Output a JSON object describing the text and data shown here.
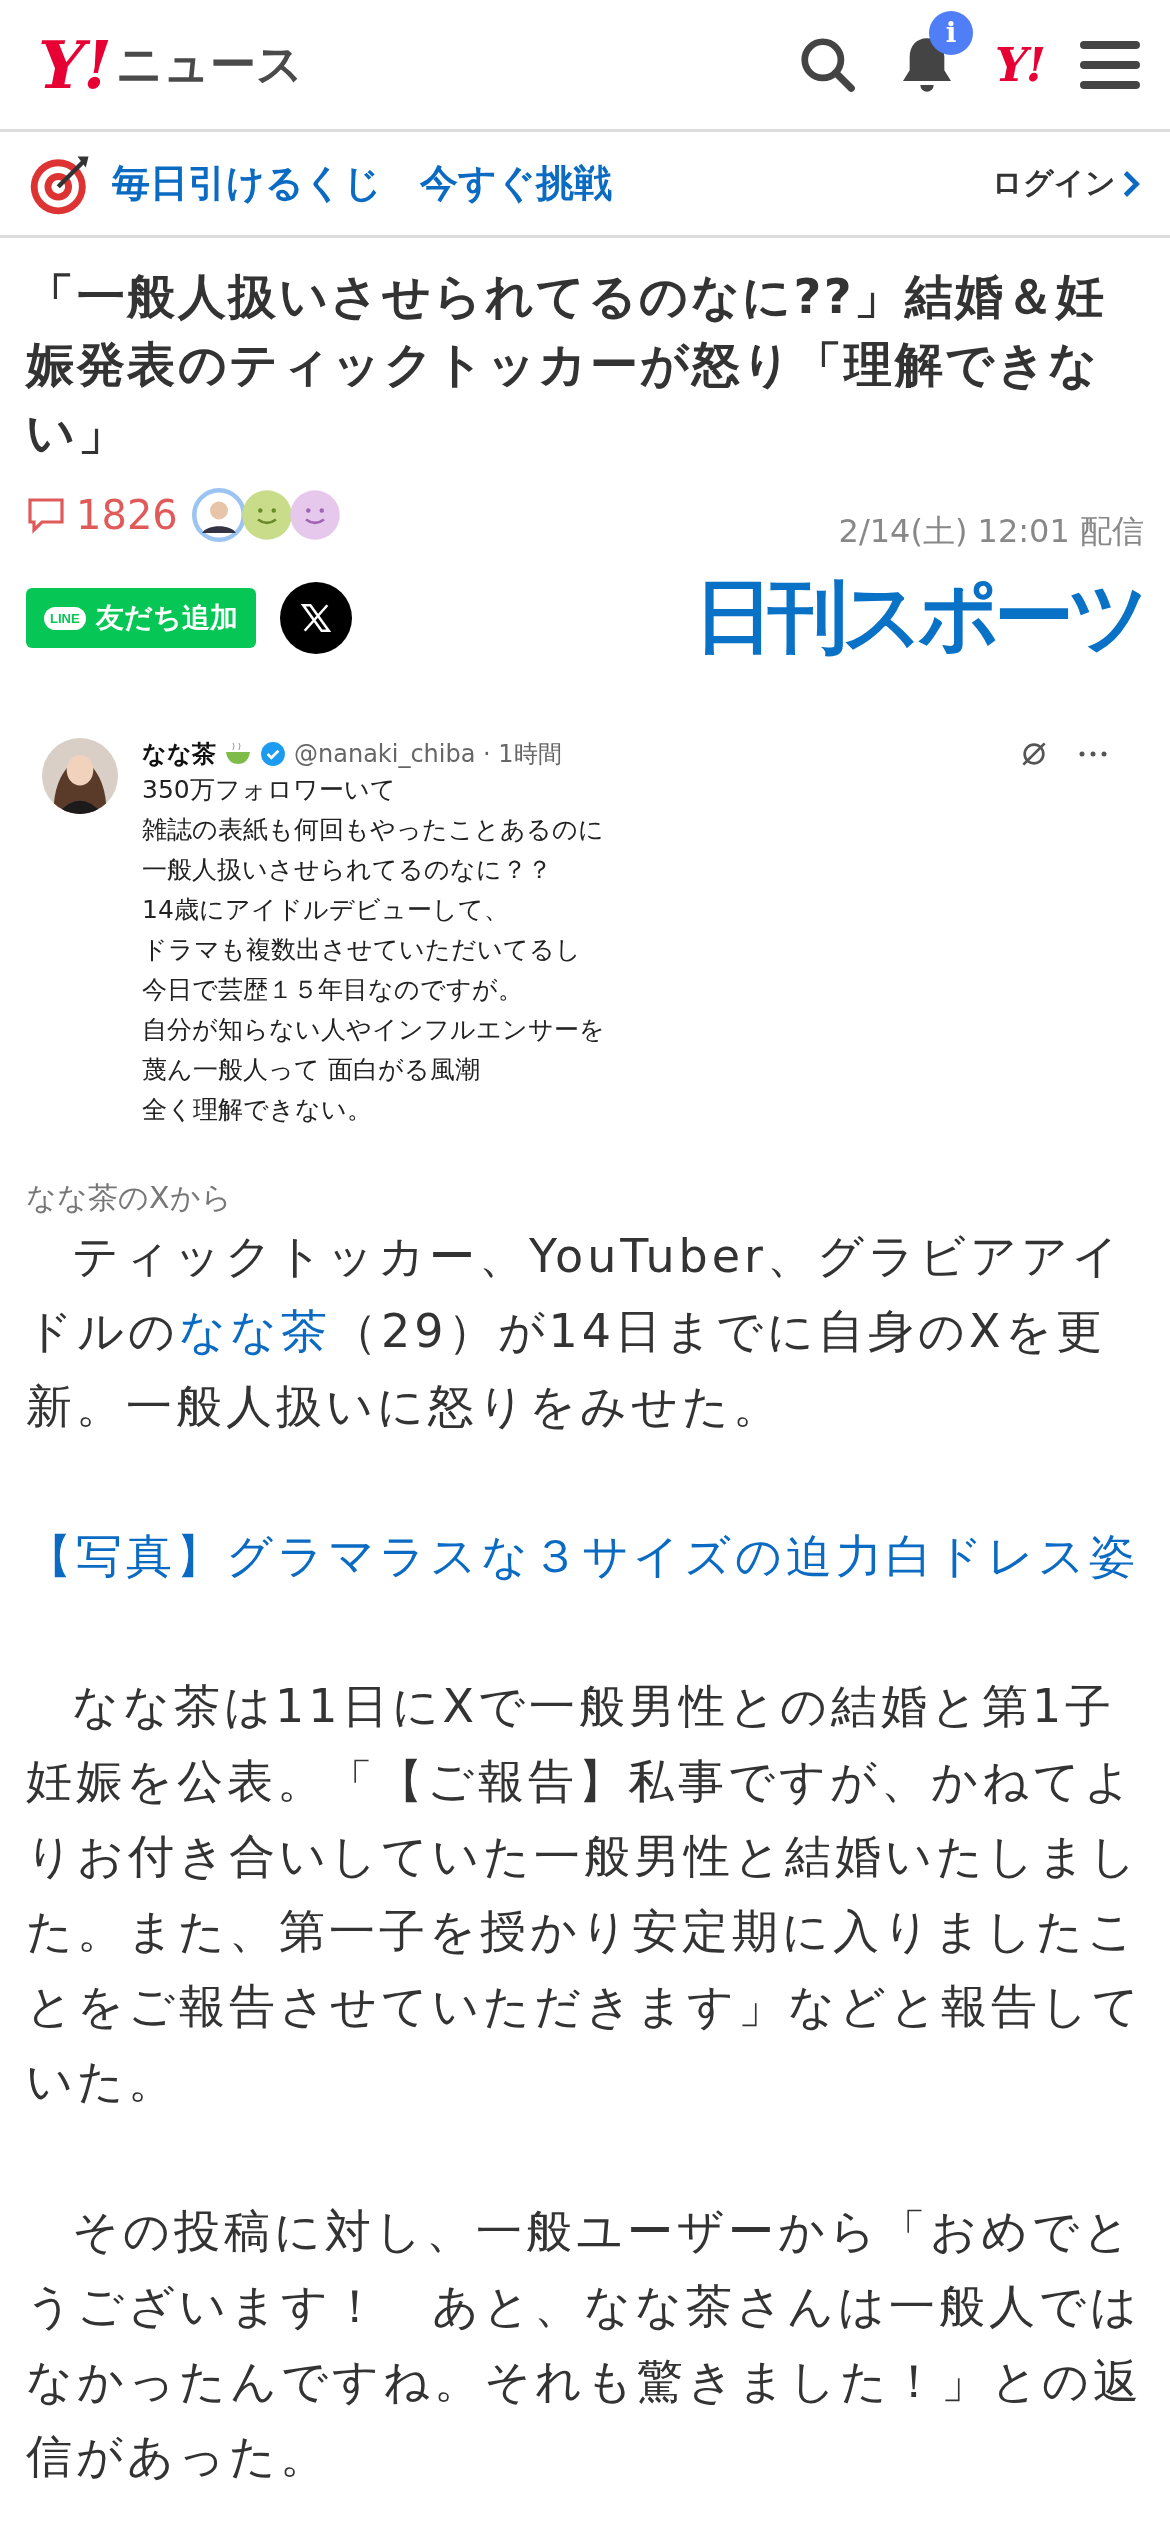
{
  "header": {
    "logo_mark": "Y!",
    "logo_text": "ニュース",
    "notice_badge": "i",
    "account_logo": "Y!"
  },
  "promo": {
    "text": "毎日引けるくじ　今すぐ挑戦",
    "login": "ログイン"
  },
  "article": {
    "title": "「一般人扱いさせられてるのなに??」結婚＆妊娠発表のティックトッカーが怒り「理解できない」",
    "comment_count": "1826",
    "date": "2/14(土) 12:01 配信",
    "line_badge": "LINE",
    "line_button": "友だち追加",
    "source": "日刊スポーツ",
    "embed": {
      "name": "なな茶",
      "handle": "@nanaki_chiba · 1時間",
      "lines": [
        "350万フォロワーいて",
        "雑誌の表紙も何回もやったことあるのに",
        "一般人扱いさせられてるのなに？？",
        "14歳にアイドルデビューして、",
        "ドラマも複数出させていただいてるし",
        "今日で芸歴１５年目なのですが。",
        "自分が知らない人やインフルエンサーを",
        "蔑ん一般人って 面白がる風潮",
        "全く理解できない。"
      ]
    },
    "caption": "なな茶のXから",
    "paragraphs": [
      {
        "parts": [
          {
            "kind": "text",
            "text": "ティックトッカー、YouTuber、グラビアアイドルの"
          },
          {
            "kind": "link",
            "text": "なな茶"
          },
          {
            "kind": "text",
            "text": "（29）が14日までに自身のXを更新。一般人扱いに怒りをみせた。"
          }
        ]
      },
      {
        "parts": [
          {
            "kind": "link",
            "text": "【写真】グラマラスな３サイズの迫力白ドレス姿"
          }
        ]
      },
      {
        "parts": [
          {
            "kind": "text",
            "text": "なな茶は11日にXで一般男性との結婚と第1子妊娠を公表。「【ご報告】私事ですが、かねてよりお付き合いしていた一般男性と結婚いたしました。また、第一子を授かり安定期に入りましたことをご報告させていただきます」などと報告していた。"
          }
        ]
      },
      {
        "parts": [
          {
            "kind": "text",
            "text": "その投稿に対し、一般ユーザーから「おめでとうございます！　あと、なな茶さんは一般人ではなかったんですね。それも驚きました！」との返信があった。"
          }
        ]
      }
    ]
  }
}
